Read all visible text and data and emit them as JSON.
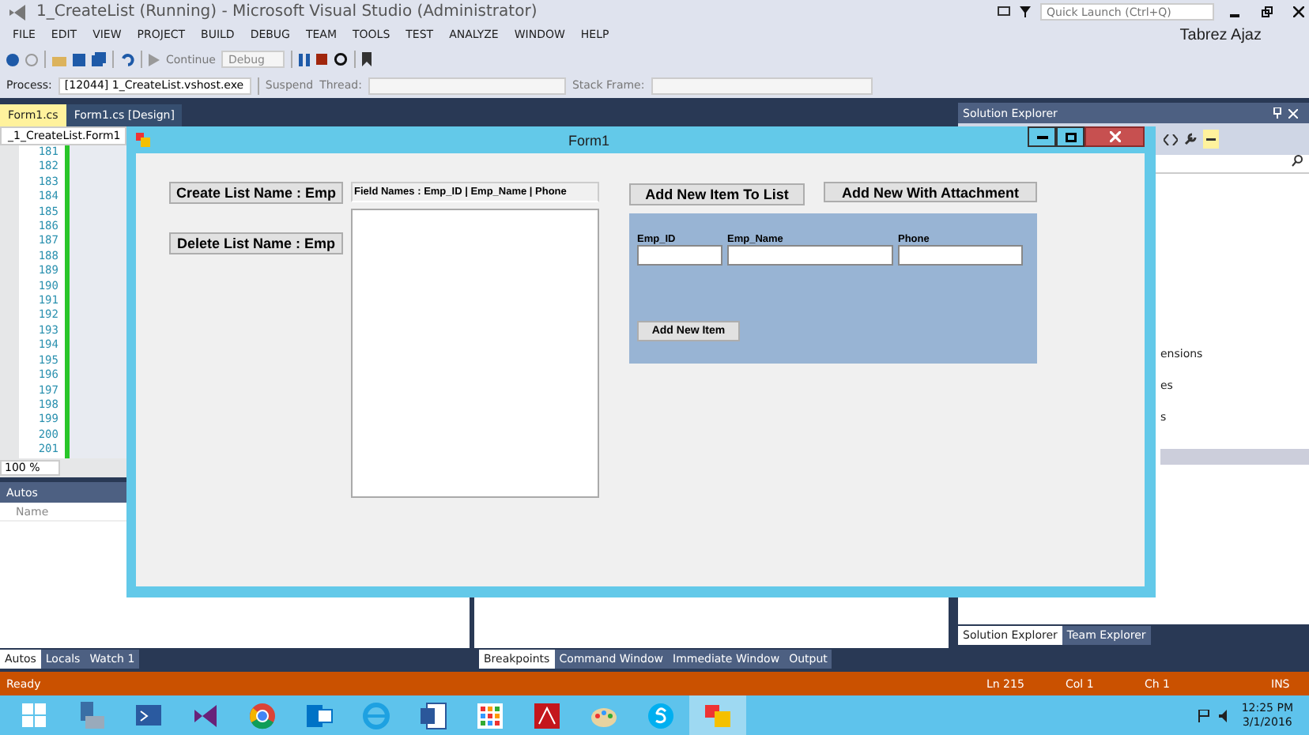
{
  "vs": {
    "title": "1_CreateList (Running) - Microsoft Visual Studio (Administrator)",
    "quick_launch": {
      "placeholder": "Quick Launch (Ctrl+Q)"
    },
    "user": "Tabrez Ajaz",
    "menu": [
      "FILE",
      "EDIT",
      "VIEW",
      "PROJECT",
      "BUILD",
      "DEBUG",
      "TEAM",
      "TOOLS",
      "TEST",
      "ANALYZE",
      "WINDOW",
      "HELP"
    ],
    "toolbar": {
      "continue": "Continue",
      "configuration": "Debug"
    },
    "debug_toolbar": {
      "process_label": "Process:",
      "process": "[12044] 1_CreateList.vshost.exe",
      "suspend": "Suspend",
      "thread_label": "Thread:",
      "stack_frame_label": "Stack Frame:"
    },
    "doc_tabs": [
      {
        "label": "Form1.cs",
        "selected": true
      },
      {
        "label": "Form1.cs [Design]",
        "selected": false
      }
    ],
    "editor": {
      "navigation": "_1_CreateList.Form1",
      "line_numbers": [
        "181",
        "182",
        "183",
        "184",
        "185",
        "186",
        "187",
        "188",
        "189",
        "190",
        "191",
        "192",
        "193",
        "194",
        "195",
        "196",
        "197",
        "198",
        "199",
        "200",
        "201"
      ],
      "zoom": "100 %"
    },
    "autos": {
      "title": "Autos",
      "column": "Name"
    },
    "left_tabs": [
      {
        "label": "Autos",
        "selected": true
      },
      {
        "label": "Locals",
        "selected": false
      },
      {
        "label": "Watch 1",
        "selected": false
      }
    ],
    "bottom_tabs": [
      {
        "label": "Breakpoints",
        "selected": true
      },
      {
        "label": "Command Window",
        "selected": false
      },
      {
        "label": "Immediate Window",
        "selected": false
      },
      {
        "label": "Output",
        "selected": false
      }
    ],
    "solution_explorer": {
      "title": "Solution Explorer",
      "items": [
        "ensions",
        "es",
        "s"
      ]
    },
    "right_tabs": [
      {
        "label": "Solution Explorer",
        "selected": true
      },
      {
        "label": "Team Explorer",
        "selected": false
      }
    ]
  },
  "form": {
    "title": "Form1",
    "create_button": "Create List Name : Emp",
    "delete_button": "Delete List Name : Emp",
    "fields_header": "Field Names : Emp_ID | Emp_Name | Phone",
    "add_to_list_button": "Add New Item To List",
    "add_attachment_button": "Add New With Attachment",
    "fields": [
      {
        "label": "Emp_ID"
      },
      {
        "label": "Emp_Name"
      },
      {
        "label": "Phone"
      }
    ],
    "add_item_button": "Add New Item"
  },
  "status_bar": {
    "text": "Ready",
    "line": "Ln 215",
    "column": "Col 1",
    "char": "Ch 1",
    "mode": "INS"
  },
  "taskbar": {
    "apps": [
      {
        "kind": "start",
        "selected": false
      },
      {
        "kind": "server",
        "selected": false
      },
      {
        "kind": "shell",
        "selected": false
      },
      {
        "kind": "studio",
        "selected": false
      },
      {
        "kind": "browser",
        "selected": false
      },
      {
        "kind": "mail",
        "selected": false
      },
      {
        "kind": "explorer",
        "selected": false
      },
      {
        "kind": "word",
        "selected": false
      },
      {
        "kind": "grid",
        "selected": false
      },
      {
        "kind": "pdf",
        "selected": false
      },
      {
        "kind": "paint",
        "selected": false
      },
      {
        "kind": "chat",
        "selected": false
      },
      {
        "kind": "form",
        "selected": true
      }
    ],
    "time": "12:25 PM",
    "date": "3/1/2016"
  }
}
